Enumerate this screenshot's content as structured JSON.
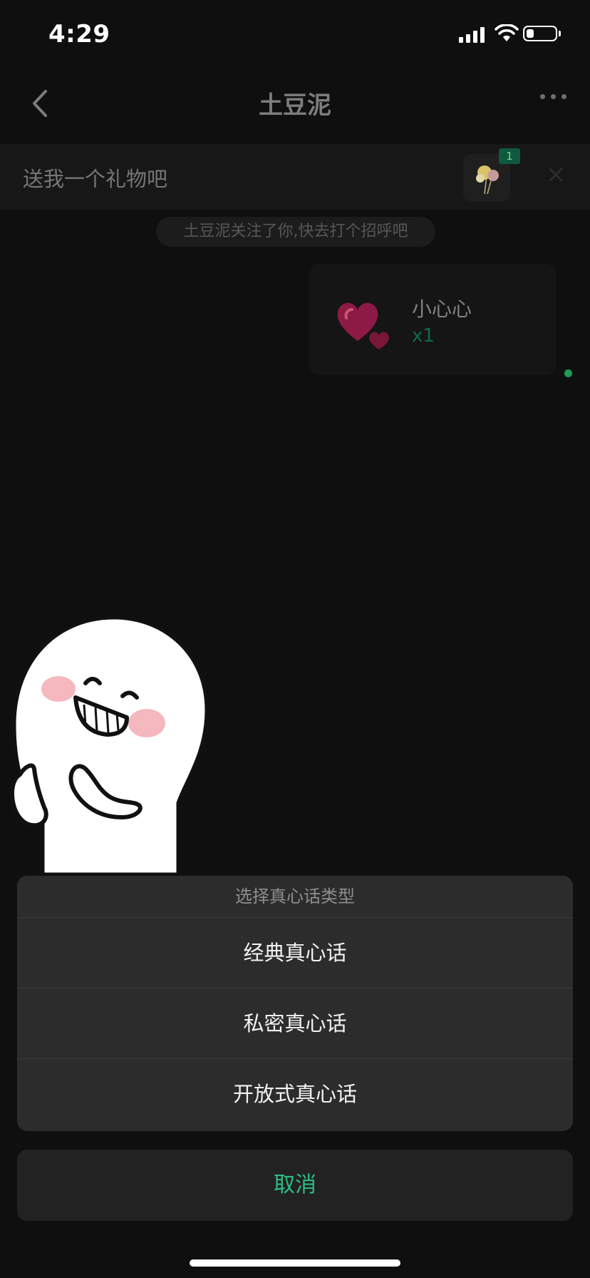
{
  "status_bar": {
    "time": "4:29",
    "battery_level": 0.25
  },
  "nav": {
    "title": "土豆泥",
    "icons": [
      "chevron-left-icon",
      "more-dots-icon"
    ]
  },
  "gift_banner": {
    "text": "送我一个礼物吧",
    "badge": "1",
    "icons": [
      "balloon-gift-icon",
      "close-icon"
    ]
  },
  "chat": {
    "system_notice": "土豆泥关注了你,快去打个招呼吧",
    "gift_message": {
      "name": "小心心",
      "quantity": "x1",
      "icon": "heart-gift-icon"
    },
    "sticker": "smiling-blob-sticker"
  },
  "action_sheet": {
    "title": "选择真心话类型",
    "options": [
      "经典真心话",
      "私密真心话",
      "开放式真心话"
    ],
    "cancel": "取消"
  },
  "colors": {
    "accent": "#2dbd82",
    "sheet_bg": "#2c2c2d",
    "background": "#0f0f10"
  }
}
